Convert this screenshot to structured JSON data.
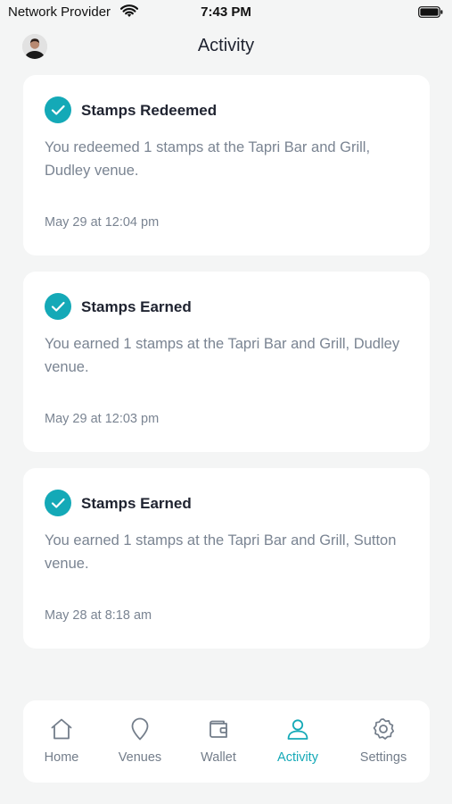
{
  "status_bar": {
    "carrier": "Network Provider",
    "time": "7:43 PM"
  },
  "header": {
    "title": "Activity"
  },
  "activities": [
    {
      "title": "Stamps Redeemed",
      "message": "You redeemed 1 stamps at the Tapri Bar and Grill, Dudley venue.",
      "timestamp": "May 29 at 12:04 pm"
    },
    {
      "title": "Stamps Earned",
      "message": "You earned 1 stamps at the Tapri Bar and Grill, Dudley venue.",
      "timestamp": "May 29 at 12:03 pm"
    },
    {
      "title": "Stamps Earned",
      "message": "You earned 1 stamps at the Tapri Bar and Grill, Sutton venue.",
      "timestamp": "May 28 at 8:18 am"
    }
  ],
  "tabbar": {
    "items": [
      {
        "label": "Home",
        "icon": "home-icon",
        "active": false
      },
      {
        "label": "Venues",
        "icon": "location-pin-icon",
        "active": false
      },
      {
        "label": "Wallet",
        "icon": "wallet-icon",
        "active": false
      },
      {
        "label": "Activity",
        "icon": "user-icon",
        "active": true
      },
      {
        "label": "Settings",
        "icon": "gear-icon",
        "active": false
      }
    ]
  },
  "colors": {
    "accent": "#14a9b7",
    "background": "#f4f5f5",
    "muted_text": "#7a8492"
  }
}
